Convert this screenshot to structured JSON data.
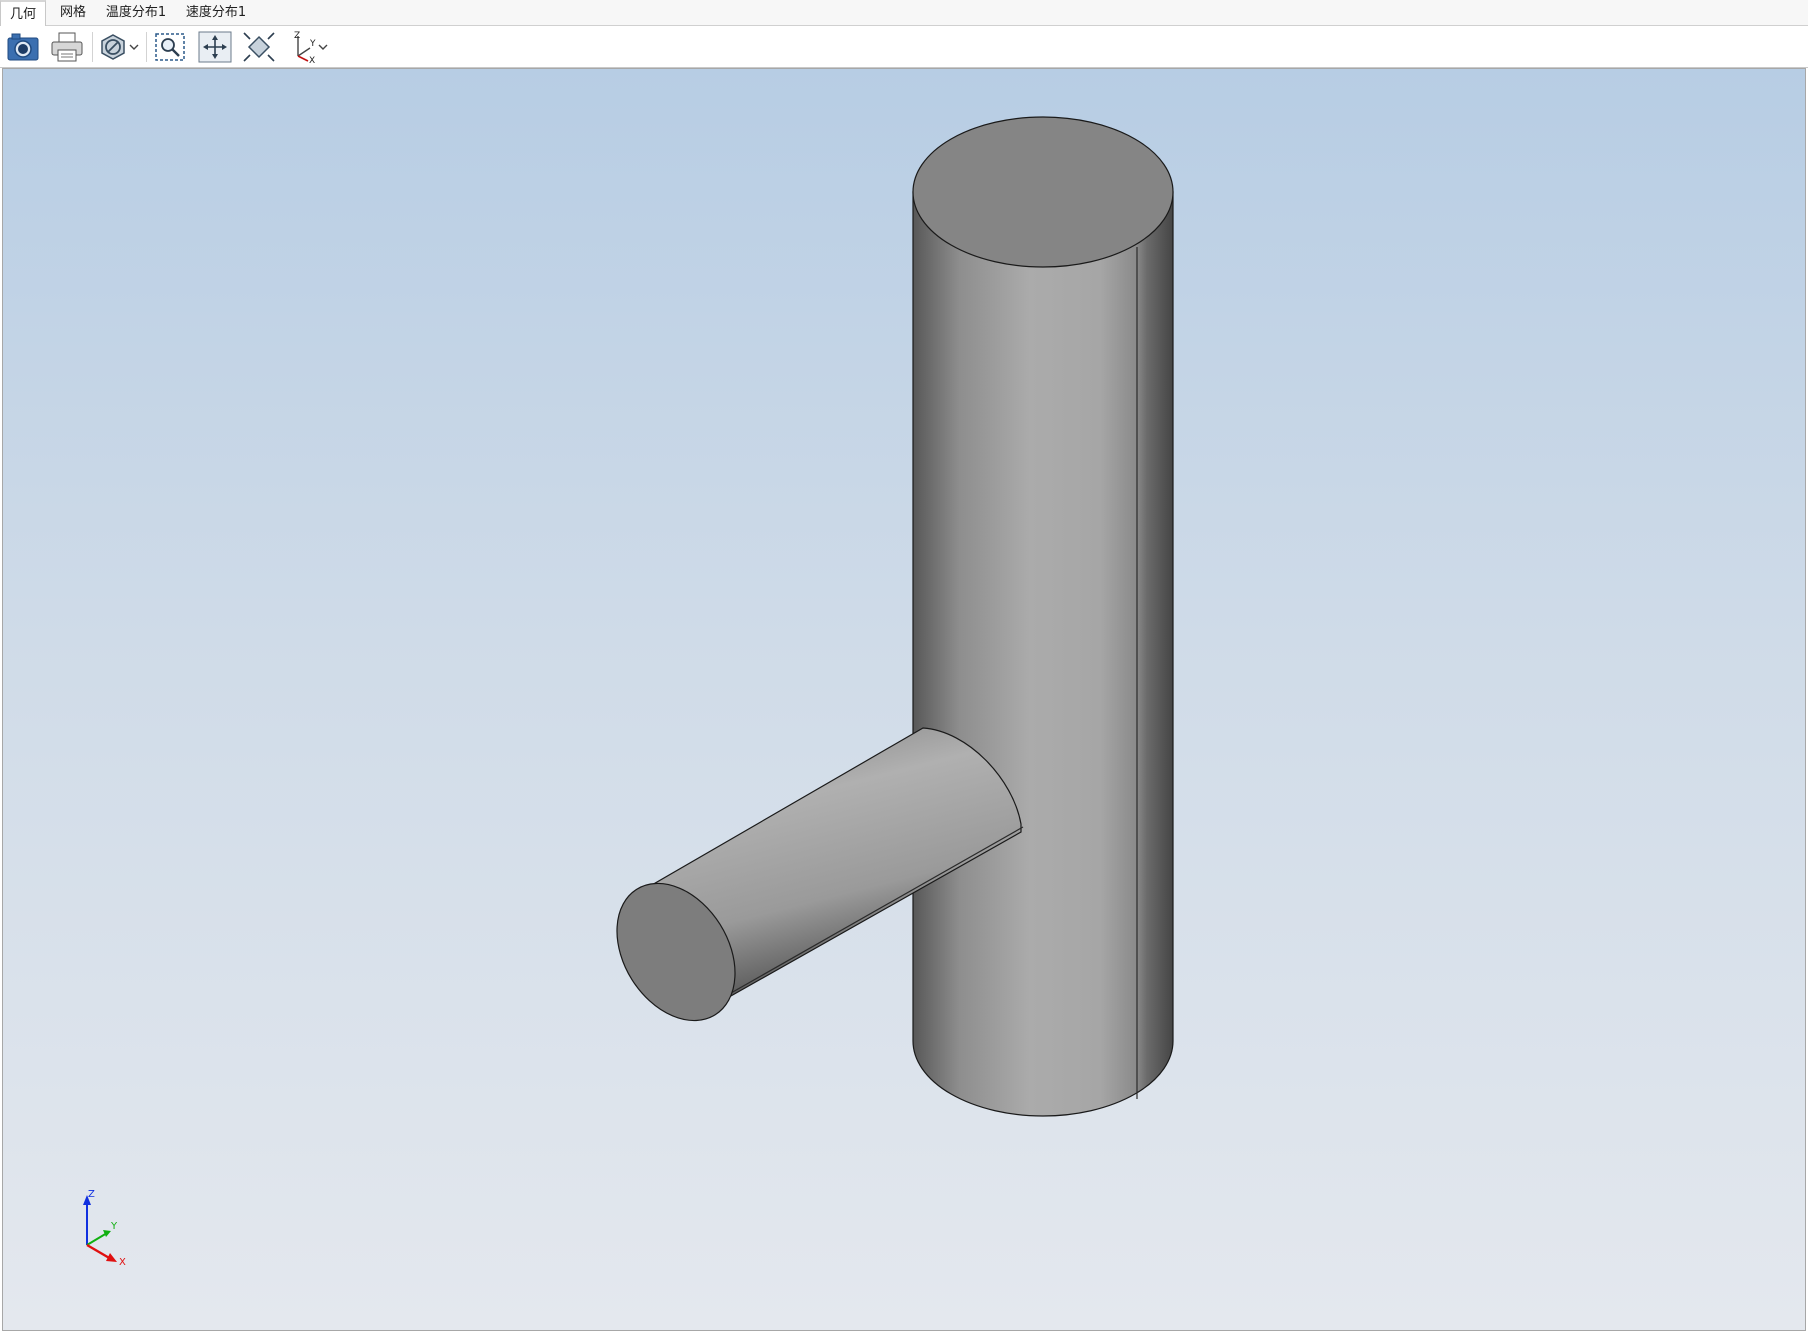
{
  "tabs": [
    {
      "label": "几何",
      "active": true
    },
    {
      "label": "网格",
      "active": false
    },
    {
      "label": "温度分布1",
      "active": false
    },
    {
      "label": "速度分布1",
      "active": false
    }
  ],
  "toolbar": {
    "icons": [
      "camera-icon",
      "print-icon",
      "render-mode-icon",
      "zoom-box-icon",
      "pan-icon",
      "fit-view-icon",
      "view-axes-icon"
    ]
  },
  "orientation": {
    "x_label": "X",
    "y_label": "Y",
    "z_label": "Z",
    "x_color": "#e01010",
    "y_color": "#10b010",
    "z_color": "#1030e0"
  },
  "colors": {
    "bg_top": "#b7cde4",
    "bg_bottom": "#e4e8ee",
    "model_gray": "#a8a8a8"
  }
}
